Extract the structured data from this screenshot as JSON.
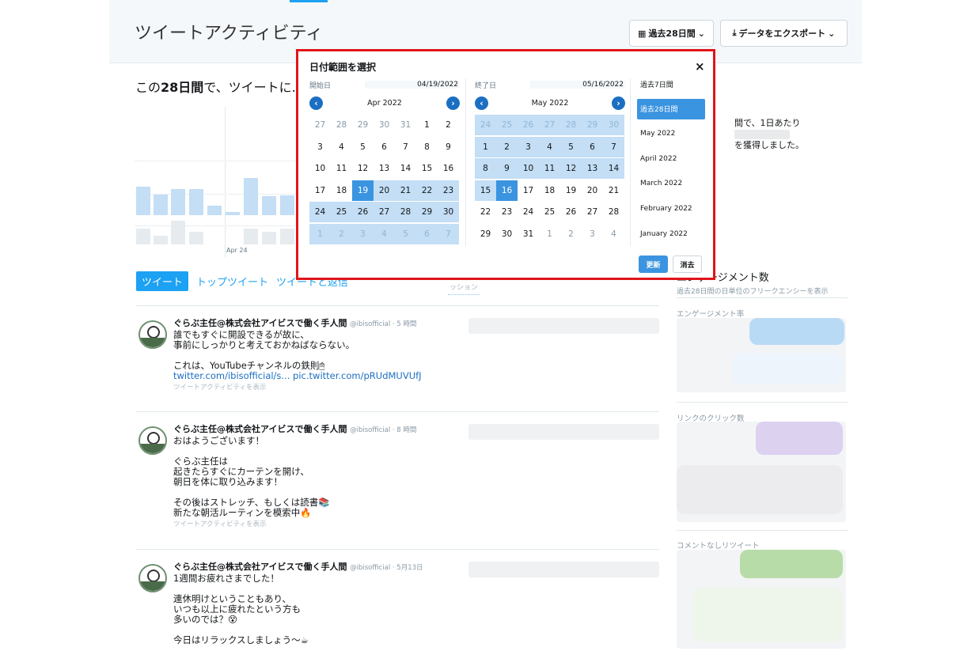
{
  "header": {
    "title": "ツイートアクティビティ",
    "range_button": "過去28日間",
    "export_button": "データをエクスポート"
  },
  "summary": {
    "prefix": "この",
    "bold": "28日間",
    "suffix": "で、ツイートに..."
  },
  "side_summary": {
    "line1_prefix": "間で、1日あたり",
    "line2": "を獲得しました。"
  },
  "chart": {
    "x_tick": "Apr 24"
  },
  "tabs": [
    {
      "label": "ツイート",
      "active": true
    },
    {
      "label": "トップツイート",
      "active": false
    },
    {
      "label": "ツイートと返信",
      "active": false
    }
  ],
  "columns": {
    "impressions": "インプレ ッション"
  },
  "tweets": [
    {
      "author": "ぐらぶ主任@株式会社アイビスで働く手人間",
      "meta": "@ibisofficial · 5 時間",
      "lines": [
        "誰でもすぐに開設できるが故に、",
        "事前にしっかりと考えておかねばならない。",
        "",
        "これは、YouTubeチャンネルの鉄則🖱"
      ],
      "link": "twitter.com/ibisofficial/s... pic.twitter.com/pRUdMUVUfJ",
      "activity": "ツイートアクティビティを表示"
    },
    {
      "author": "ぐらぶ主任@株式会社アイビスで働く手人間",
      "meta": "@ibisofficial · 8 時間",
      "lines": [
        "おはようございます！",
        "",
        "ぐらぶ主任は",
        "起きたらすぐにカーテンを開け、",
        "朝日を体に取り込みます！",
        "",
        "その後はストレッチ、もしくは読書📚",
        "新たな朝活ルーティンを模索中🔥"
      ],
      "link": "",
      "activity": "ツイートアクティビティを表示"
    },
    {
      "author": "ぐらぶ主任@株式会社アイビスで働く手人間",
      "meta": "@ibisofficial · 5月13日",
      "lines": [
        "1週間お疲れさまでした！",
        "",
        "連休明けということもあり、",
        "いつも以上に疲れたという方も",
        "多いのでは？😵",
        "",
        "今日はリラックスしましょう〜☕"
      ],
      "link": "",
      "activity": ""
    }
  ],
  "right_column": {
    "title": "エンゲージメント数",
    "subtitle": "過去28日間の日単位のフリークエンシーを表示",
    "sections": [
      "エンゲージメント率",
      "リンクのクリック数",
      "コメントなしリツイート"
    ]
  },
  "modal": {
    "title": "日付範囲を選択",
    "close": "×",
    "start": {
      "label": "開始日",
      "value": "04/19/2022",
      "month": "Apr 2022",
      "weeks": [
        [
          "27",
          "28",
          "29",
          "30",
          "31",
          "1",
          "2"
        ],
        [
          "3",
          "4",
          "5",
          "6",
          "7",
          "8",
          "9"
        ],
        [
          "10",
          "11",
          "12",
          "13",
          "14",
          "15",
          "16"
        ],
        [
          "17",
          "18",
          "19",
          "20",
          "21",
          "22",
          "23"
        ],
        [
          "24",
          "25",
          "26",
          "27",
          "28",
          "29",
          "30"
        ],
        [
          "1",
          "2",
          "3",
          "4",
          "5",
          "6",
          "7"
        ]
      ]
    },
    "end": {
      "label": "終了日",
      "value": "05/16/2022",
      "month": "May 2022",
      "weeks": [
        [
          "24",
          "25",
          "26",
          "27",
          "28",
          "29",
          "30"
        ],
        [
          "1",
          "2",
          "3",
          "4",
          "5",
          "6",
          "7"
        ],
        [
          "8",
          "9",
          "10",
          "11",
          "12",
          "13",
          "14"
        ],
        [
          "15",
          "16",
          "17",
          "18",
          "19",
          "20",
          "21"
        ],
        [
          "22",
          "23",
          "24",
          "25",
          "26",
          "27",
          "28"
        ],
        [
          "29",
          "30",
          "31",
          "1",
          "2",
          "3",
          "4"
        ]
      ]
    },
    "presets": [
      "過去7日間",
      "過去28日間",
      "May 2022",
      "April 2022",
      "March 2022",
      "February 2022",
      "January 2022"
    ],
    "active_preset": 1,
    "update": "更新",
    "clear": "消去"
  },
  "colors": {
    "accent": "#1da1f2",
    "selected_range": "#c3def5",
    "highlight": "#3b94e0",
    "modal_border": "#e0151a"
  }
}
